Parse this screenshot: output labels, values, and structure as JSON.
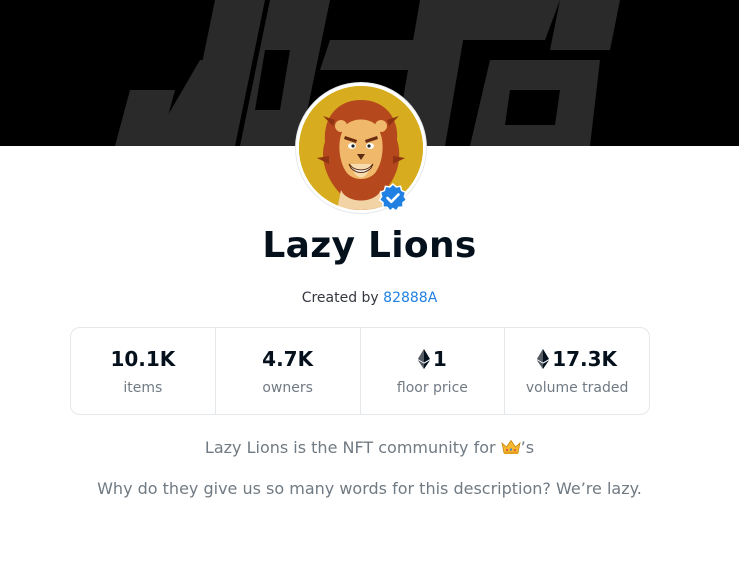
{
  "collection": {
    "title": "Lazy Lions",
    "created_by_label": "Created by",
    "creator": "82888A",
    "avatar_icon": "lion-avatar-icon",
    "verified_icon": "verified-badge-icon"
  },
  "stats": [
    {
      "value": "10.1K",
      "label": "items",
      "eth": false
    },
    {
      "value": "4.7K",
      "label": "owners",
      "eth": false
    },
    {
      "value": "1",
      "label": "floor price",
      "eth": true
    },
    {
      "value": "17.3K",
      "label": "volume traded",
      "eth": true
    }
  ],
  "description": {
    "line1_prefix": "Lazy Lions is the NFT community for",
    "line1_suffix": "’s",
    "line1_icon": "crown-emoji-icon",
    "line2": "Why do they give us so many words for this description? We’re lazy."
  },
  "colors": {
    "banner": "#000000",
    "link": "#2081e2",
    "verified": "#2081e2",
    "title": "#04111d",
    "muted": "#707a83",
    "avatar_bg": "#d7ad1f"
  }
}
